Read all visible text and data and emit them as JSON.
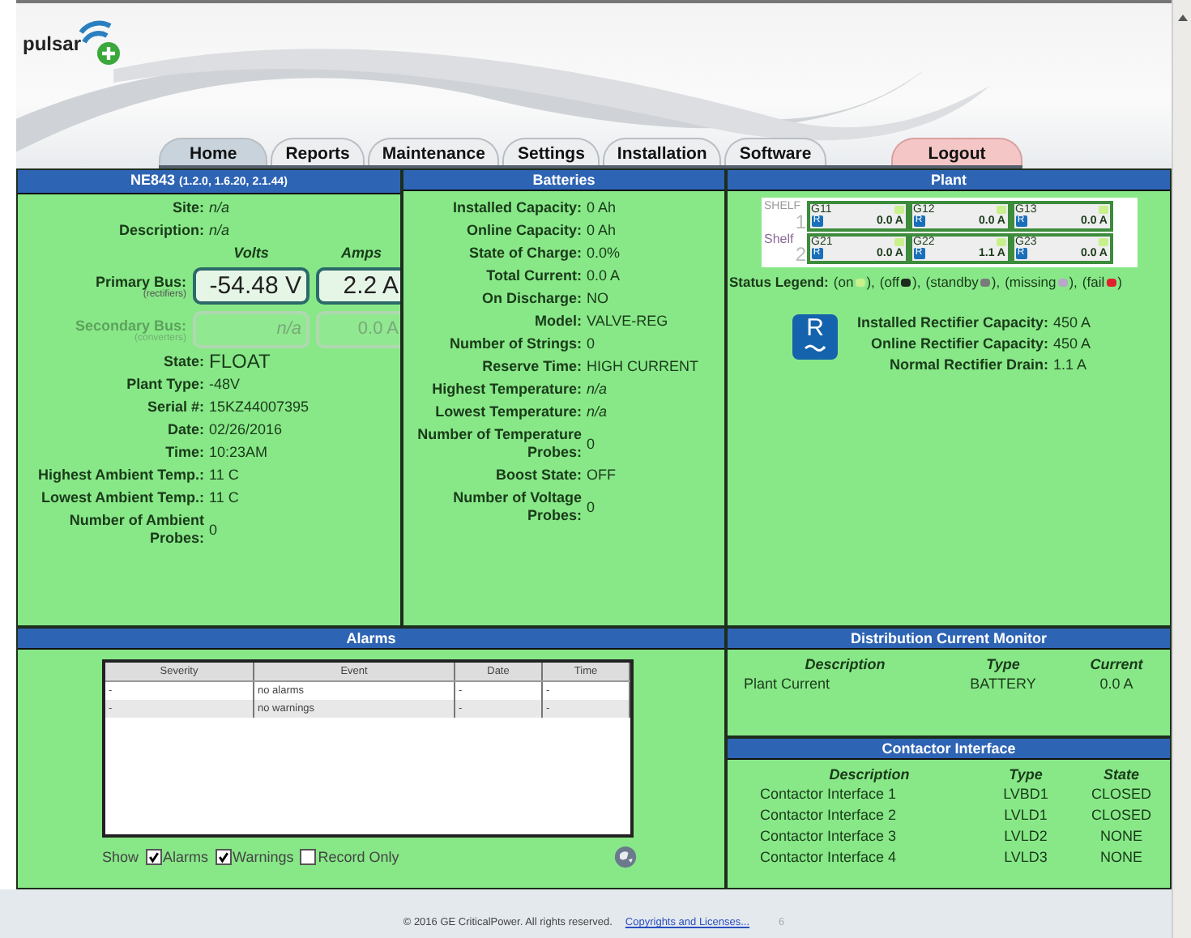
{
  "logo": {
    "text": "pulsar"
  },
  "tabs": [
    {
      "label": "Home",
      "selected": true,
      "kind": "nav"
    },
    {
      "label": "Reports",
      "selected": false,
      "kind": "nav"
    },
    {
      "label": "Maintenance",
      "selected": false,
      "kind": "nav"
    },
    {
      "label": "Settings",
      "selected": false,
      "kind": "nav"
    },
    {
      "label": "Installation",
      "selected": false,
      "kind": "nav"
    },
    {
      "label": "Software",
      "selected": false,
      "kind": "nav"
    },
    {
      "label": "Logout",
      "selected": false,
      "kind": "logout"
    }
  ],
  "controller": {
    "title": "NE843",
    "versions": "(1.2.0, 1.6.20, 2.1.44)",
    "top_fields": [
      {
        "label": "Site:",
        "value": "n/a",
        "kind": "italic"
      },
      {
        "label": "Description:",
        "value": "n/a",
        "kind": "italic"
      }
    ],
    "bus_headers": [
      "Volts",
      "Amps"
    ],
    "buses": [
      {
        "label": "Primary Bus:",
        "sublabel": "(rectifiers)",
        "volts": "-54.48 V",
        "amps": "2.2 A",
        "disabled": false
      },
      {
        "label": "Secondary Bus:",
        "sublabel": "(converters)",
        "volts": "n/a",
        "amps": "0.0 A",
        "disabled": true
      }
    ],
    "fields": [
      {
        "label": "State:",
        "value": "FLOAT",
        "kind": "large"
      },
      {
        "label": "Plant Type:",
        "value": "-48V",
        "kind": "plain"
      },
      {
        "label": "Serial #:",
        "value": "15KZ44007395",
        "kind": "plain"
      },
      {
        "label": "Date:",
        "value": "02/26/2016",
        "kind": "plain"
      },
      {
        "label": "Time:",
        "value": "10:23AM",
        "kind": "plain"
      },
      {
        "label": "Highest Ambient Temp.:",
        "value": "11 C",
        "kind": "plain"
      },
      {
        "label": "Lowest Ambient Temp.:",
        "value": "11 C",
        "kind": "plain"
      },
      {
        "label": "Number of Ambient Probes:",
        "value": "0",
        "kind": "plain"
      }
    ]
  },
  "batteries": {
    "title": "Batteries",
    "fields": [
      {
        "label": "Installed Capacity:",
        "value": "0 Ah",
        "kind": "plain"
      },
      {
        "label": "Online Capacity:",
        "value": "0 Ah",
        "kind": "plain"
      },
      {
        "label": "State of Charge:",
        "value": "0.0%",
        "kind": "plain"
      },
      {
        "label": "Total Current:",
        "value": "0.0 A",
        "kind": "plain"
      },
      {
        "label": "On Discharge:",
        "value": "NO",
        "kind": "plain"
      },
      {
        "label": "Model:",
        "value": "VALVE-REG",
        "kind": "plain"
      },
      {
        "label": "Number of Strings:",
        "value": "0",
        "kind": "plain"
      },
      {
        "label": "Reserve Time:",
        "value": "HIGH CURRENT",
        "kind": "plain"
      },
      {
        "label": "Highest Temperature:",
        "value": "n/a",
        "kind": "italic"
      },
      {
        "label": "Lowest Temperature:",
        "value": "n/a",
        "kind": "italic"
      },
      {
        "label": "Number of Temperature Probes:",
        "value": "0",
        "kind": "plain"
      },
      {
        "label": "Boost State:",
        "value": "OFF",
        "kind": "plain"
      },
      {
        "label": "Number of Voltage Probes:",
        "value": "0",
        "kind": "plain"
      }
    ]
  },
  "plant": {
    "title": "Plant",
    "shelves": [
      {
        "label": "SHELF",
        "number": "1",
        "slots": [
          {
            "id": "G11",
            "badge": "R",
            "current": "0.0 A",
            "color": "#c8f08c"
          },
          {
            "id": "G12",
            "badge": "R",
            "current": "0.0 A",
            "color": "#c8f08c"
          },
          {
            "id": "G13",
            "badge": "R",
            "current": "0.0 A",
            "color": "#c8f08c"
          }
        ]
      },
      {
        "label": "Shelf",
        "number": "2",
        "slots": [
          {
            "id": "G21",
            "badge": "R",
            "current": "0.0 A",
            "color": "#c8f08c"
          },
          {
            "id": "G22",
            "badge": "R",
            "current": "1.1 A",
            "color": "#c8f08c"
          },
          {
            "id": "G23",
            "badge": "R",
            "current": "0.0 A",
            "color": "#c8f08c"
          }
        ]
      }
    ],
    "legend_label": "Status Legend:",
    "legend": [
      {
        "label": "(on",
        "color": "#c8f08c",
        "close": "),"
      },
      {
        "label": "(off",
        "color": "#1e2a1e",
        "close": "),"
      },
      {
        "label": "(standby",
        "color": "#7a7a7a",
        "close": "),"
      },
      {
        "label": "(missing",
        "color": "#b8a8c8",
        "close": "),"
      },
      {
        "label": "(fail",
        "color": "#e0202c",
        "close": ")"
      }
    ],
    "rectifier_icon": {
      "letter": "R"
    },
    "fields": [
      {
        "label": "Installed Rectifier Capacity:",
        "value": "450 A"
      },
      {
        "label": "Online Rectifier Capacity:",
        "value": "450 A"
      },
      {
        "label": "Normal Rectifier Drain:",
        "value": "1.1 A"
      }
    ]
  },
  "alarms": {
    "title": "Alarms",
    "columns": [
      "Severity",
      "Event",
      "Date",
      "Time"
    ],
    "rows": [
      [
        "-",
        "no alarms",
        "-",
        "-"
      ],
      [
        "-",
        "no warnings",
        "-",
        "-"
      ]
    ],
    "show_label": "Show",
    "options": [
      {
        "label": "Alarms",
        "checked": true
      },
      {
        "label": "Warnings",
        "checked": true
      },
      {
        "label": "Record Only",
        "checked": false
      }
    ]
  },
  "distribution": {
    "title": "Distribution Current Monitor",
    "columns": [
      "Description",
      "Type",
      "Current"
    ],
    "rows": [
      [
        "Plant Current",
        "BATTERY",
        "0.0 A"
      ]
    ]
  },
  "contactors": {
    "title": "Contactor Interface",
    "columns": [
      "Description",
      "Type",
      "State"
    ],
    "rows": [
      [
        "Contactor Interface 1",
        "LVBD1",
        "CLOSED"
      ],
      [
        "Contactor Interface 2",
        "LVLD1",
        "CLOSED"
      ],
      [
        "Contactor Interface 3",
        "LVLD2",
        "NONE"
      ],
      [
        "Contactor Interface 4",
        "LVLD3",
        "NONE"
      ]
    ]
  },
  "footer": {
    "copyright": "© 2016 GE CriticalPower. All rights reserved.",
    "link": "Copyrights and Licenses...",
    "page": "6"
  }
}
